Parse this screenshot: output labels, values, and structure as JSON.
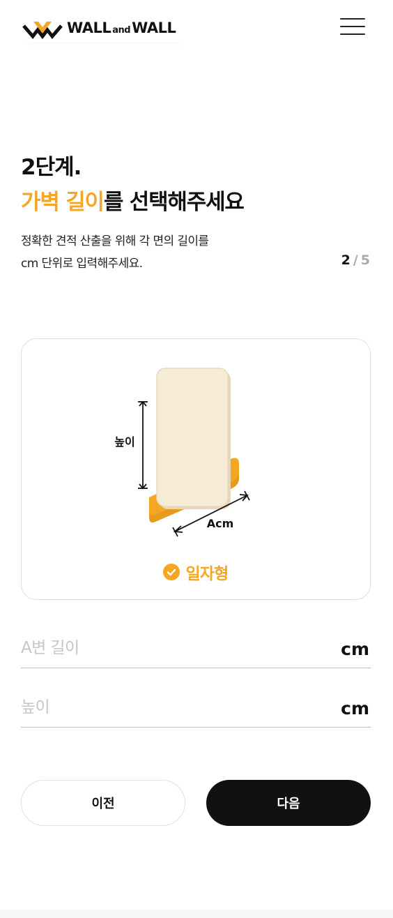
{
  "header": {
    "brand_left": "WALL",
    "brand_and": "and",
    "brand_right": "WALL",
    "menu_icon": "hamburger-menu-icon"
  },
  "step": {
    "label": "2단계.",
    "current": "2",
    "separator": "/",
    "total": "5"
  },
  "headline": {
    "accent": "가벽 길이",
    "rest": "를 선택해주세요"
  },
  "description": {
    "line1": "정확한 견적 산출을 위해 각 면의 길이를",
    "line2": "cm 단위로 입력해주세요."
  },
  "illustration": {
    "height_label": "높이",
    "length_label": "Acm"
  },
  "selected_type": {
    "icon": "check-circle-icon",
    "label": "일자형"
  },
  "fields": [
    {
      "placeholder": "A변 길이",
      "value": "",
      "unit": "cm"
    },
    {
      "placeholder": "높이",
      "value": "",
      "unit": "cm"
    }
  ],
  "buttons": {
    "prev": "이전",
    "next": "다음"
  },
  "colors": {
    "accent": "#F5A623",
    "dark": "#111111",
    "panel": "#F4E9D5"
  }
}
